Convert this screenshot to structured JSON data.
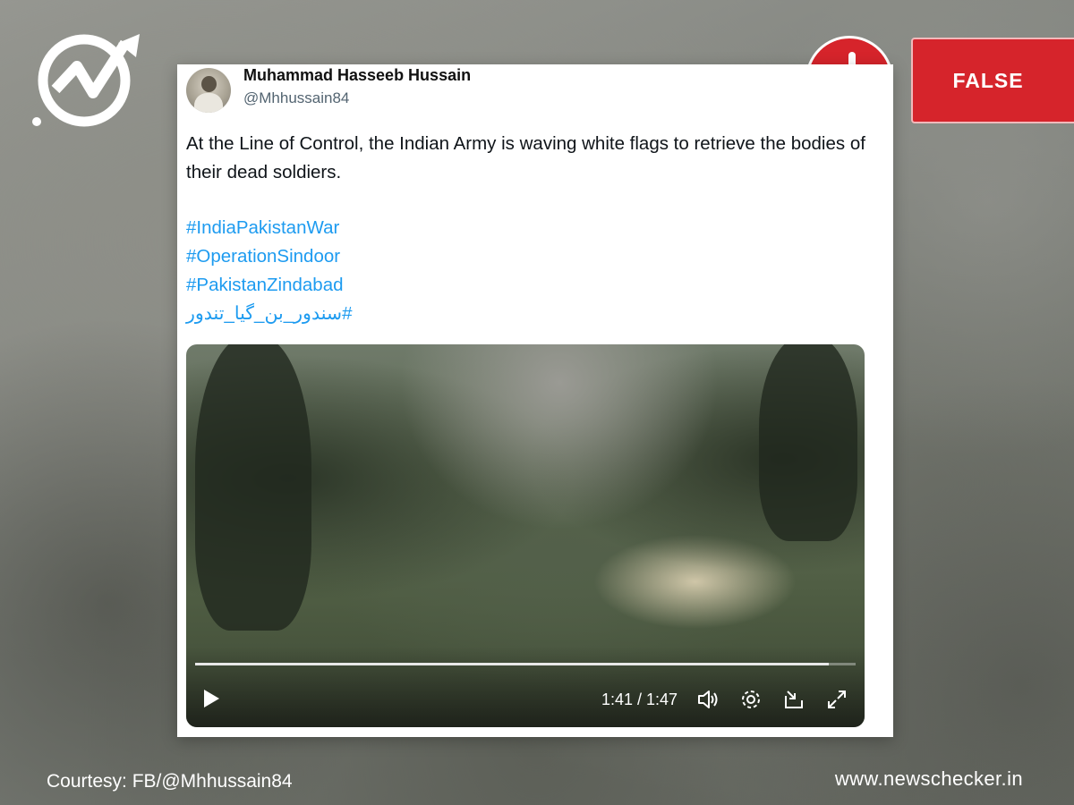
{
  "brand": {
    "logo_icon": "newschecker-logo-icon",
    "accent_color": "#d6242b",
    "website": "www.newschecker.in"
  },
  "verdict": {
    "icon": "exclamation-icon",
    "label": "FALSE"
  },
  "post": {
    "author_name": "Muhammad Hasseeb Hussain",
    "author_handle": "@Mhhussain84",
    "text": "At the Line of Control, the Indian Army is waving white flags to retrieve the bodies of their dead soldiers.",
    "hashtags": [
      "#IndiaPakistanWar",
      "#OperationSindoor",
      "#PakistanZindabad",
      "#سندور_بن_گیا_تندور"
    ],
    "hashtag_color": "#1d9bf0"
  },
  "video": {
    "progress_fraction": 0.96,
    "time_display": "1:41 / 1:47",
    "controls": [
      "play-icon",
      "volume-icon",
      "settings-icon",
      "pip-icon",
      "fullscreen-icon"
    ]
  },
  "footer": {
    "courtesy": "Courtesy: FB/@Mhhussain84"
  }
}
